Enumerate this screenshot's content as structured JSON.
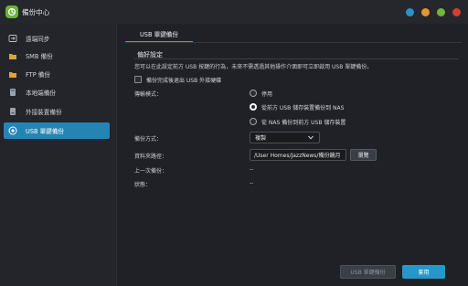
{
  "window": {
    "title": "備份中心",
    "controls": [
      "blue-dot",
      "orange-dot",
      "green-dot",
      "red-dot"
    ]
  },
  "sidebar": {
    "items": [
      {
        "label": "遠端同步",
        "icon": "sync-icon"
      },
      {
        "label": "SMB 備份",
        "icon": "smb-backup-icon"
      },
      {
        "label": "FTP 備份",
        "icon": "ftp-backup-icon"
      },
      {
        "label": "本地端備份",
        "icon": "local-backup-icon"
      },
      {
        "label": "外接裝置備份",
        "icon": "external-device-icon"
      },
      {
        "label": "USB 單鍵備份",
        "icon": "usb-backup-icon",
        "active": true
      }
    ]
  },
  "tabs": [
    {
      "label": "USB 單鍵備份",
      "active": true
    }
  ],
  "main": {
    "section_title": "偏好設定",
    "description": "您可以在此設定前方 USB 按鍵的行為，未來不需透過其他操作介面即可立即啟用 USB 單鍵備份。",
    "eject_checkbox": {
      "label": "備份完成後退出 USB 外接硬碟",
      "checked": false
    },
    "transfer_mode": {
      "label": "傳輸模式：",
      "options": [
        {
          "label": "停用",
          "selected": false
        },
        {
          "label": "從前方 USB 儲存裝置備份到 NAS",
          "selected": true
        },
        {
          "label": "從 NAS 備份到前方 USB 儲存裝置",
          "selected": false
        }
      ]
    },
    "backup_method": {
      "label": "備份方式：",
      "value": "複製"
    },
    "folder_path": {
      "label": "資料夾路徑：",
      "value": "/User Homes/JazzNews/備份鏡月",
      "browse_label": "瀏覽"
    },
    "last_backup": {
      "label": "上一次備份：",
      "value": "--"
    },
    "status": {
      "label": "狀態：",
      "value": "--"
    }
  },
  "footer": {
    "usb_backup_button": "USB 單鍵備份",
    "apply_button": "套用"
  },
  "colors": {
    "accent": "#2896c9",
    "active_sidebar": "#2684b4",
    "background": "#1f2126"
  }
}
